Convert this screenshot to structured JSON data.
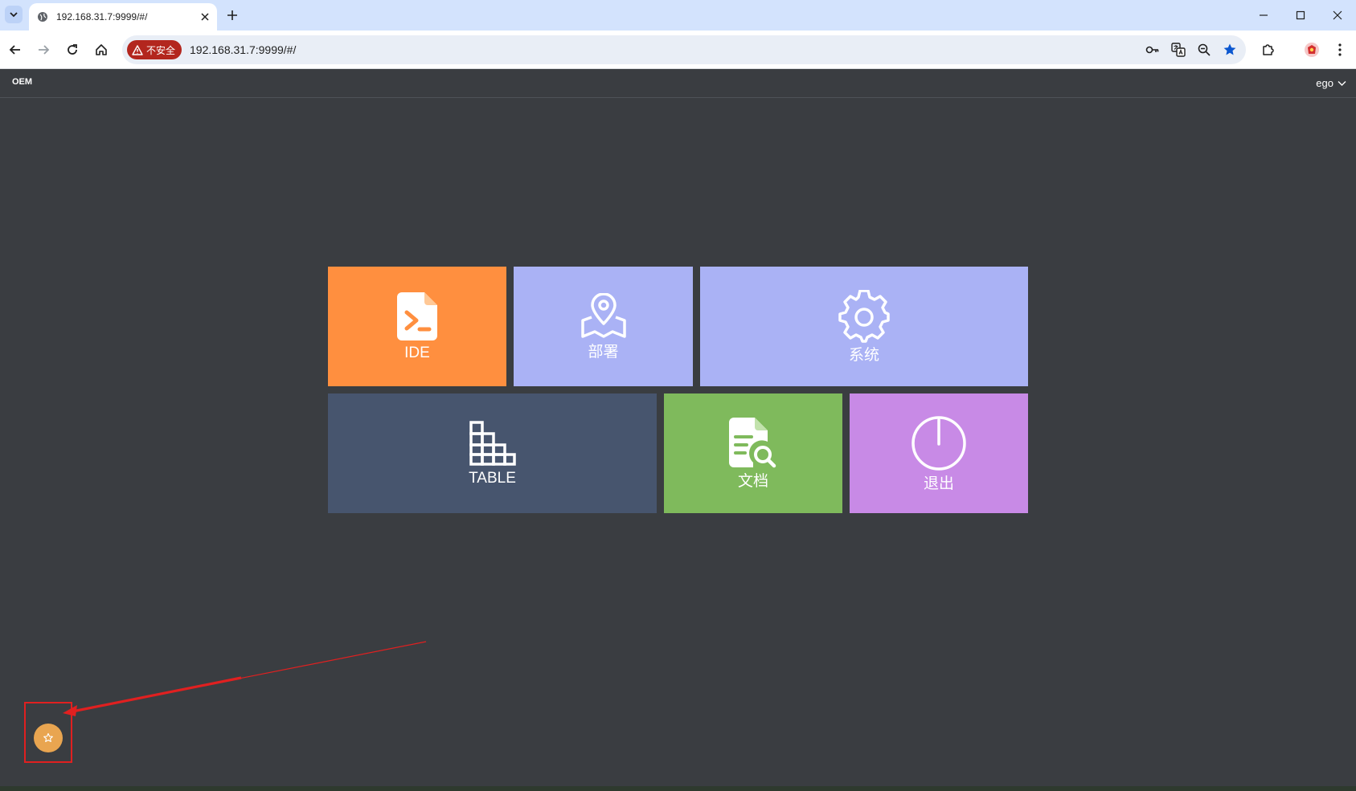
{
  "browser": {
    "tab_title": "192.168.31.7:9999/#/",
    "url": "192.168.31.7:9999/#/",
    "security_chip": "不安全"
  },
  "header": {
    "brand": "OEM",
    "user": "ego"
  },
  "tiles": [
    {
      "label": "IDE",
      "icon": "terminal-file-icon",
      "color": "#ff8f3f"
    },
    {
      "label": "部署",
      "icon": "map-pin-icon",
      "color": "#aab2f5"
    },
    {
      "label": "系统",
      "icon": "gear-icon",
      "color": "#aab2f5"
    },
    {
      "label": "TABLE",
      "icon": "table-grid-icon",
      "color": "#47556e"
    },
    {
      "label": "文档",
      "icon": "document-search-icon",
      "color": "#7fba5c"
    },
    {
      "label": "退出",
      "icon": "power-icon",
      "color": "#c88ae6"
    }
  ],
  "floating_button": {
    "icon": "star-icon",
    "color": "#e9a550"
  },
  "annotation_color": "#e02020"
}
